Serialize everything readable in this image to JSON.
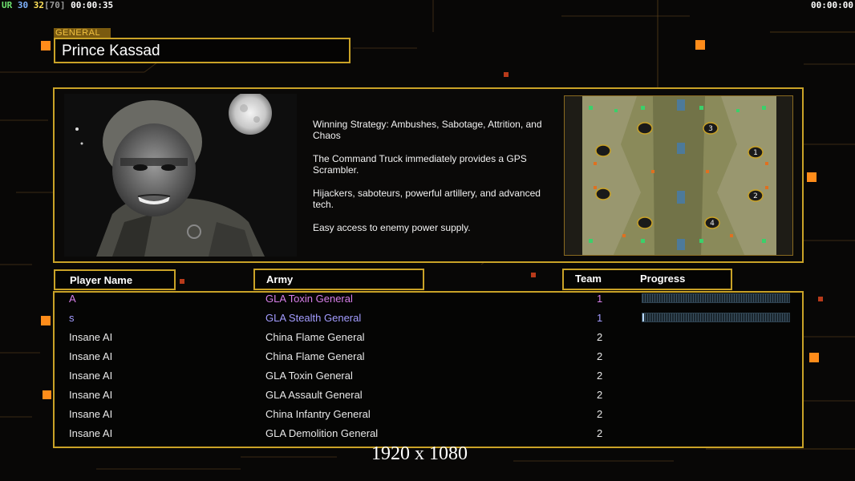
{
  "hud": {
    "ur": "UR",
    "a": "30",
    "b": "32",
    "c": "[70]",
    "time_left": "00:00:35",
    "time_right": "00:00:00"
  },
  "general": {
    "tag": "GENERAL",
    "name": "Prince Kassad"
  },
  "strategy": [
    "Winning Strategy: Ambushes, Sabotage, Attrition, and Chaos",
    "The Command Truck immediately provides a GPS Scrambler.",
    "Hijackers, saboteurs, powerful artillery, and advanced tech.",
    "Easy access to enemy power supply."
  ],
  "map": {
    "start_positions": [
      "1",
      "2",
      "3",
      "4"
    ]
  },
  "table": {
    "headers": {
      "player": "Player Name",
      "army": "Army",
      "team": "Team",
      "progress": "Progress"
    },
    "rows": [
      {
        "name": "A",
        "army": "GLA Toxin General",
        "team": "1",
        "color": "#d67ee8",
        "progress": 0
      },
      {
        "name": "s",
        "army": "GLA Stealth General",
        "team": "1",
        "color": "#a39cff",
        "progress": 0.01
      },
      {
        "name": "Insane AI",
        "army": "China Flame General",
        "team": "2",
        "color": "#e8e8e8"
      },
      {
        "name": "Insane AI",
        "army": "China Flame General",
        "team": "2",
        "color": "#e8e8e8"
      },
      {
        "name": "Insane AI",
        "army": "GLA Toxin General",
        "team": "2",
        "color": "#e8e8e8"
      },
      {
        "name": "Insane AI",
        "army": "GLA Assault General",
        "team": "2",
        "color": "#e8e8e8"
      },
      {
        "name": "Insane AI",
        "army": "China Infantry General",
        "team": "2",
        "color": "#e8e8e8"
      },
      {
        "name": "Insane AI",
        "army": "GLA Demolition General",
        "team": "2",
        "color": "#e8e8e8"
      }
    ]
  },
  "resolution_label": "1920 x 1080",
  "colors": {
    "accent": "#c9a227",
    "background": "#080706",
    "glow": "#ff8c1a"
  }
}
